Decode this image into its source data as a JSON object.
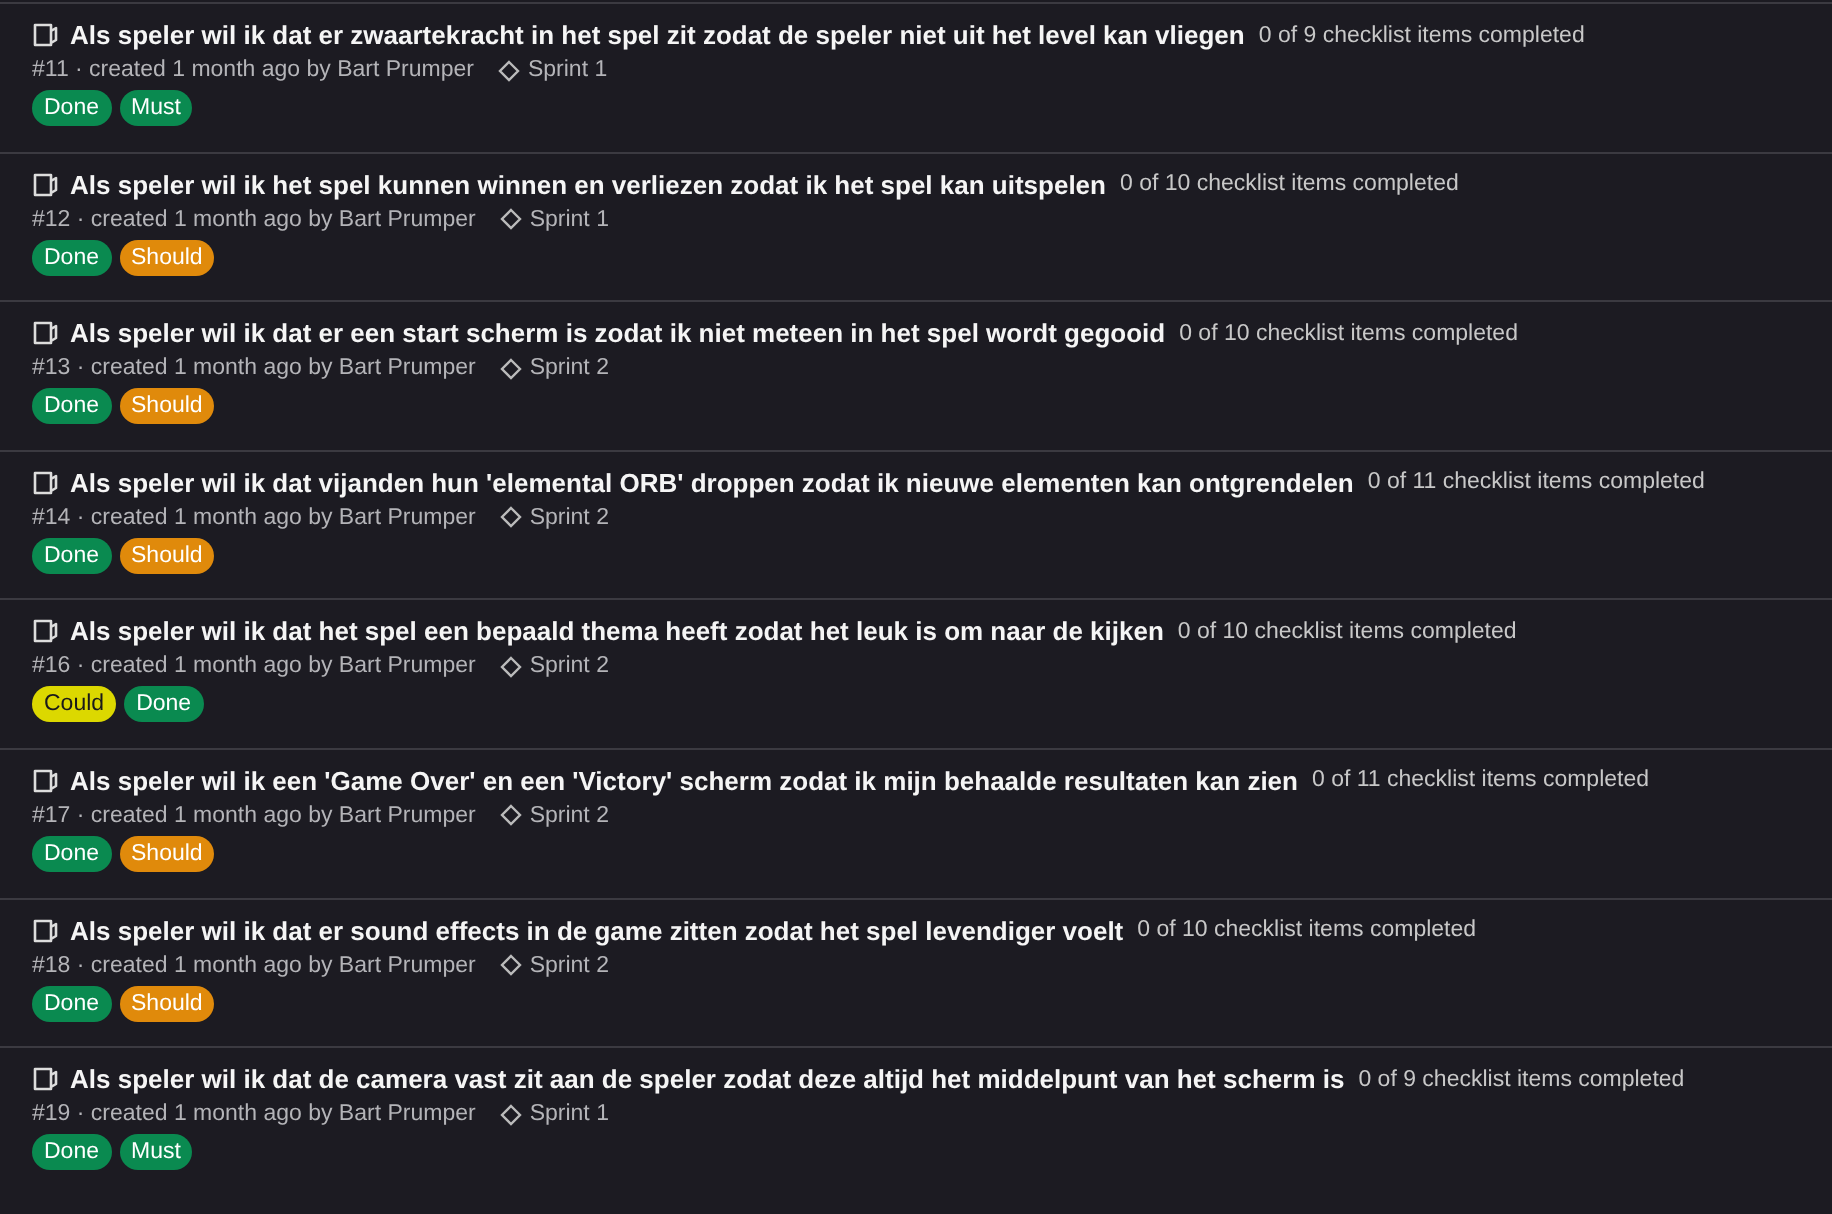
{
  "issues": [
    {
      "title": "Als speler wil ik dat er zwaartekracht in het spel zit zodat de speler niet uit het level kan vliegen",
      "checklist": "0 of 9 checklist items completed",
      "meta": "#11 · created 1 month ago by Bart Prumper",
      "milestone": "Sprint 1",
      "labels": [
        {
          "text": "Done",
          "color": "#0a8a50"
        },
        {
          "text": "Must",
          "color": "#0a8a50"
        }
      ]
    },
    {
      "title": "Als speler wil ik het spel kunnen winnen en verliezen zodat ik het spel kan uitspelen",
      "checklist": "0 of 10 checklist items completed",
      "meta": "#12 · created 1 month ago by Bart Prumper",
      "milestone": "Sprint 1",
      "labels": [
        {
          "text": "Done",
          "color": "#0a8a50"
        },
        {
          "text": "Should",
          "color": "#e08a0b"
        }
      ]
    },
    {
      "title": "Als speler wil ik dat er een start scherm is zodat ik niet meteen in het spel wordt gegooid",
      "checklist": "0 of 10 checklist items completed",
      "meta": "#13 · created 1 month ago by Bart Prumper",
      "milestone": "Sprint 2",
      "labels": [
        {
          "text": "Done",
          "color": "#0a8a50"
        },
        {
          "text": "Should",
          "color": "#e08a0b"
        }
      ]
    },
    {
      "title": "Als speler wil ik dat vijanden hun 'elemental ORB' droppen zodat ik nieuwe elementen kan ontgrendelen",
      "checklist": "0 of 11 checklist items completed",
      "meta": "#14 · created 1 month ago by Bart Prumper",
      "milestone": "Sprint 2",
      "labels": [
        {
          "text": "Done",
          "color": "#0a8a50"
        },
        {
          "text": "Should",
          "color": "#e08a0b"
        }
      ]
    },
    {
      "title": "Als speler wil ik dat het spel een bepaald thema heeft zodat het leuk is om naar de kijken",
      "checklist": "0 of 10 checklist items completed",
      "meta": "#16 · created 1 month ago by Bart Prumper",
      "milestone": "Sprint 2",
      "labels": [
        {
          "text": "Could",
          "color": "#dcd800"
        },
        {
          "text": "Done",
          "color": "#0a8a50"
        }
      ]
    },
    {
      "title": "Als speler wil ik een 'Game Over' en een 'Victory' scherm zodat ik mijn behaalde resultaten kan zien",
      "checklist": "0 of 11 checklist items completed",
      "meta": "#17 · created 1 month ago by Bart Prumper",
      "milestone": "Sprint 2",
      "labels": [
        {
          "text": "Done",
          "color": "#0a8a50"
        },
        {
          "text": "Should",
          "color": "#e08a0b"
        }
      ]
    },
    {
      "title": "Als speler wil ik dat er sound effects in de game zitten zodat het spel levendiger voelt",
      "checklist": "0 of 10 checklist items completed",
      "meta": "#18 · created 1 month ago by Bart Prumper",
      "milestone": "Sprint 2",
      "labels": [
        {
          "text": "Done",
          "color": "#0a8a50"
        },
        {
          "text": "Should",
          "color": "#e08a0b"
        }
      ]
    },
    {
      "title": "Als speler wil ik dat de camera vast zit aan de speler zodat deze altijd het middelpunt van het scherm is",
      "checklist": "0 of 9 checklist items completed",
      "meta": "#19 · created 1 month ago by Bart Prumper",
      "milestone": "Sprint 1",
      "labels": [
        {
          "text": "Done",
          "color": "#0a8a50"
        },
        {
          "text": "Must",
          "color": "#0a8a50"
        }
      ]
    }
  ]
}
